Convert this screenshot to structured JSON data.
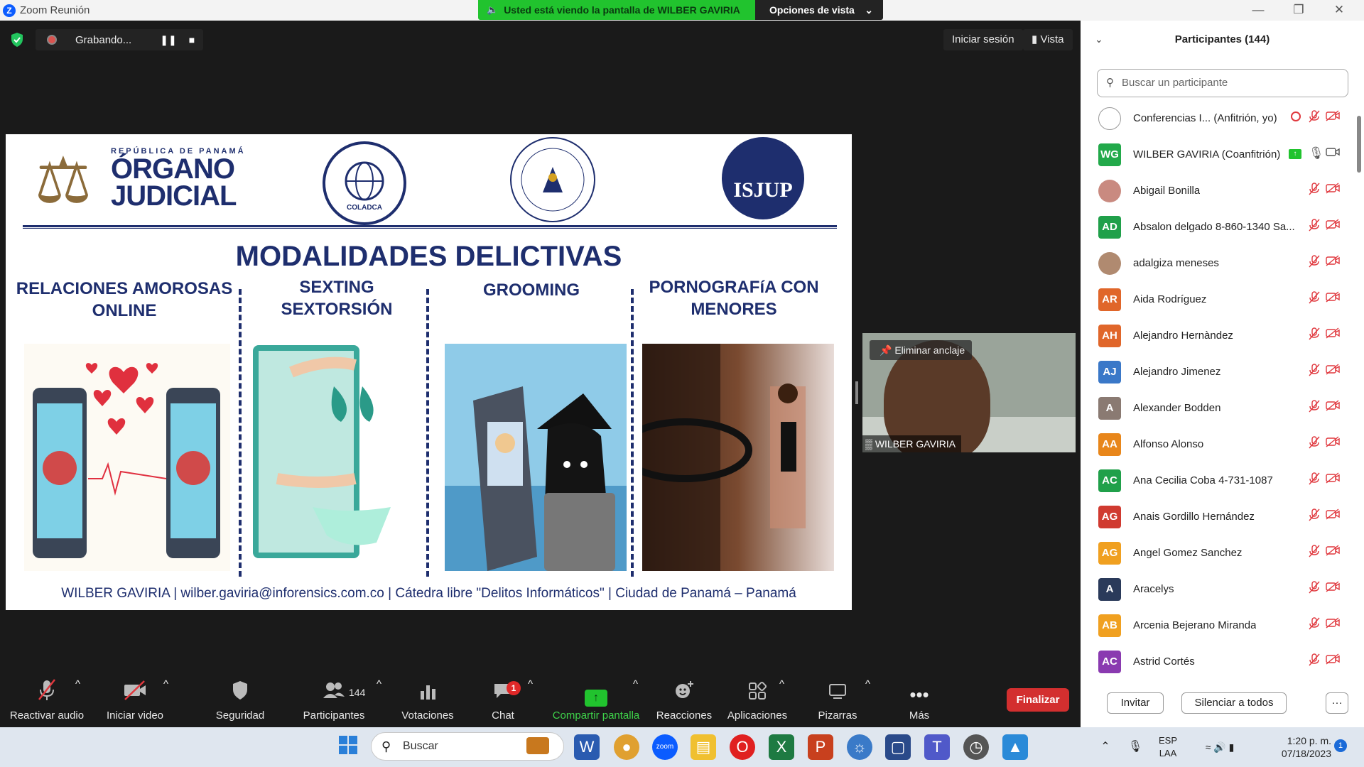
{
  "window": {
    "title": "Zoom Reunión"
  },
  "banner": {
    "viewing": "Usted está viendo la pantalla de WILBER GAVIRIA",
    "options": "Opciones de vista"
  },
  "recording": {
    "label": "Grabando..."
  },
  "topbar": {
    "signin": "Iniciar sesión",
    "view": "Vista"
  },
  "slide": {
    "org_small": "REPÚBLICA DE PANAMÁ",
    "org_big_1": "ÓRGANO",
    "org_big_2": "JUDICIAL",
    "coladca": "COLADCA",
    "isjup": "ISJUP",
    "title": "MODALIDADES DELICTIVAS",
    "categories": [
      {
        "l1": "RELACIONES AMOROSAS",
        "l2": "ONLINE"
      },
      {
        "l1": "SEXTING",
        "l2": "SEXTORSIÓN"
      },
      {
        "l1": "GROOMING",
        "l2": ""
      },
      {
        "l1": "PORNOGRAFíA CON",
        "l2": "MENORES"
      }
    ],
    "footer": "WILBER GAVIRIA |  wilber.gaviria@inforensics.com.co | Cátedra libre \"Delitos Informáticos\"  | Ciudad de Panamá – Panamá"
  },
  "selfview": {
    "unpin": "Eliminar anclaje",
    "name": "WILBER GAVIRIA"
  },
  "toolbar": {
    "audio": "Reactivar audio",
    "video": "Iniciar video",
    "security": "Seguridad",
    "participants": "Participantes",
    "participants_count": "144",
    "polls": "Votaciones",
    "chat": "Chat",
    "chat_badge": "1",
    "share": "Compartir pantalla",
    "reactions": "Reacciones",
    "apps": "Aplicaciones",
    "whiteboards": "Pizarras",
    "more": "Más",
    "end": "Finalizar"
  },
  "panel": {
    "title": "Participantes (144)",
    "search_placeholder": "Buscar un participante",
    "invite": "Invitar",
    "mute_all": "Silenciar a todos",
    "more": "···",
    "participants": [
      {
        "initials": "",
        "name": "Conferencias I...  (Anfitrión, yo)",
        "color": "#ffffff"
      },
      {
        "initials": "WG",
        "name": "WILBER GAVIRIA (Coanfitrión)",
        "color": "#22a94a"
      },
      {
        "initials": "",
        "name": "Abigail Bonilla",
        "color": "#c98a80"
      },
      {
        "initials": "AD",
        "name": "Absalon delgado 8-860-1340  Sa...",
        "color": "#20a04a"
      },
      {
        "initials": "",
        "name": "adalgiza meneses",
        "color": "#b08a70"
      },
      {
        "initials": "AR",
        "name": "Aida Rodríguez",
        "color": "#e0662a"
      },
      {
        "initials": "AH",
        "name": "Alejandro Hernàndez",
        "color": "#e0662a"
      },
      {
        "initials": "AJ",
        "name": "Alejandro Jimenez",
        "color": "#3a78c8"
      },
      {
        "initials": "A",
        "name": "Alexander Bodden",
        "color": "#8a7a72"
      },
      {
        "initials": "AA",
        "name": "Alfonso Alonso",
        "color": "#e8861a"
      },
      {
        "initials": "AC",
        "name": "Ana Cecilia Coba 4-731-1087",
        "color": "#20a04a"
      },
      {
        "initials": "AG",
        "name": "Anais Gordillo Hernández",
        "color": "#d03a30"
      },
      {
        "initials": "AG",
        "name": "Angel Gomez Sanchez",
        "color": "#f0a020"
      },
      {
        "initials": "A",
        "name": "Aracelys",
        "color": "#2a3a5a"
      },
      {
        "initials": "AB",
        "name": "Arcenia Bejerano Miranda",
        "color": "#f0a020"
      },
      {
        "initials": "AC",
        "name": "Astrid Cortés",
        "color": "#8a3ab0"
      }
    ]
  },
  "taskbar": {
    "search": "Buscar",
    "lang1": "ESP",
    "lang2": "LAA",
    "time": "1:20 p. m.",
    "date": "07/18/2023",
    "notif": "1"
  }
}
